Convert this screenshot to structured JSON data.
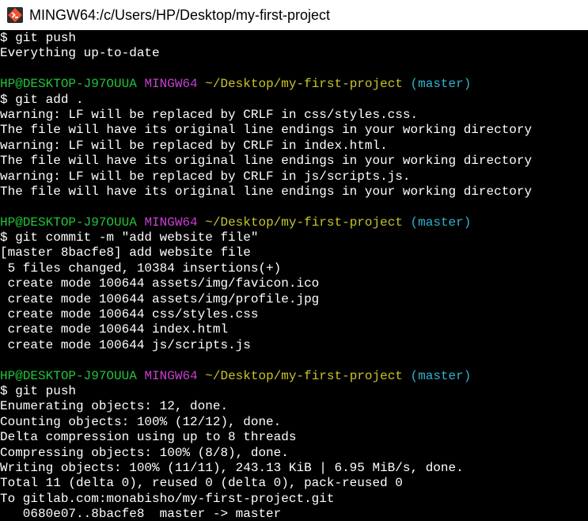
{
  "window": {
    "title": "MINGW64:/c/Users/HP/Desktop/my-first-project",
    "icon": "git-bash-icon"
  },
  "colors": {
    "user_host": "#22c43a",
    "shell": "#c93fd1",
    "path": "#c9c42a",
    "branch": "#2fb4d1",
    "text": "#ffffff",
    "background": "#000000"
  },
  "terminal": {
    "lines": [
      {
        "text": "$ git push"
      },
      {
        "text": "Everything up-to-date"
      },
      {
        "text": ""
      },
      {
        "prompt": {
          "user_host": "HP@DESKTOP-J97OUUA",
          "shell": "MINGW64",
          "path": "~/Desktop/my-first-project",
          "branch": "(master)"
        }
      },
      {
        "text": "$ git add ."
      },
      {
        "text": "warning: LF will be replaced by CRLF in css/styles.css."
      },
      {
        "text": "The file will have its original line endings in your working directory"
      },
      {
        "text": "warning: LF will be replaced by CRLF in index.html."
      },
      {
        "text": "The file will have its original line endings in your working directory"
      },
      {
        "text": "warning: LF will be replaced by CRLF in js/scripts.js."
      },
      {
        "text": "The file will have its original line endings in your working directory"
      },
      {
        "text": ""
      },
      {
        "prompt": {
          "user_host": "HP@DESKTOP-J97OUUA",
          "shell": "MINGW64",
          "path": "~/Desktop/my-first-project",
          "branch": "(master)"
        }
      },
      {
        "text": "$ git commit -m \"add website file\""
      },
      {
        "text": "[master 8bacfe8] add website file"
      },
      {
        "text": " 5 files changed, 10384 insertions(+)"
      },
      {
        "text": " create mode 100644 assets/img/favicon.ico"
      },
      {
        "text": " create mode 100644 assets/img/profile.jpg"
      },
      {
        "text": " create mode 100644 css/styles.css"
      },
      {
        "text": " create mode 100644 index.html"
      },
      {
        "text": " create mode 100644 js/scripts.js"
      },
      {
        "text": ""
      },
      {
        "prompt": {
          "user_host": "HP@DESKTOP-J97OUUA",
          "shell": "MINGW64",
          "path": "~/Desktop/my-first-project",
          "branch": "(master)"
        }
      },
      {
        "text": "$ git push"
      },
      {
        "text": "Enumerating objects: 12, done."
      },
      {
        "text": "Counting objects: 100% (12/12), done."
      },
      {
        "text": "Delta compression using up to 8 threads"
      },
      {
        "text": "Compressing objects: 100% (8/8), done."
      },
      {
        "text": "Writing objects: 100% (11/11), 243.13 KiB | 6.95 MiB/s, done."
      },
      {
        "text": "Total 11 (delta 0), reused 0 (delta 0), pack-reused 0"
      },
      {
        "text": "To gitlab.com:monabisho/my-first-project.git"
      },
      {
        "text": "   0680e07..8bacfe8  master -> master"
      }
    ]
  }
}
